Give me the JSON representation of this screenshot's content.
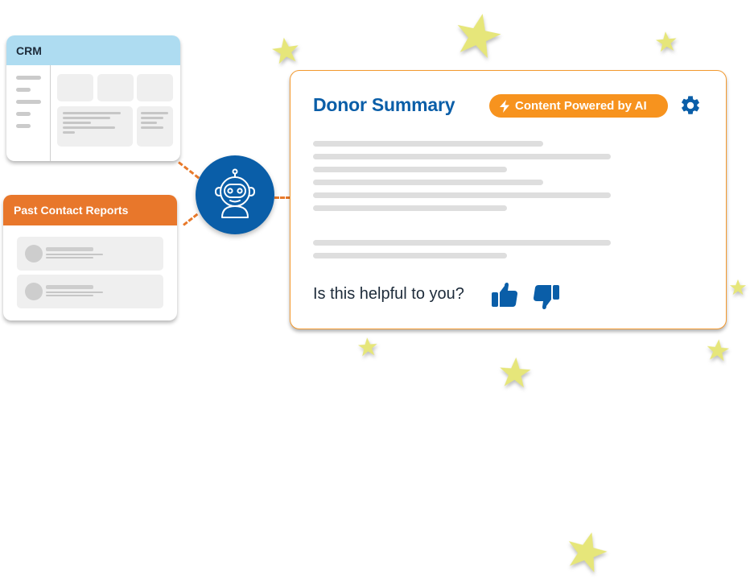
{
  "colors": {
    "crm_header": "#aedcf1",
    "reports_header": "#e8772b",
    "brand_blue": "#0a5ea8",
    "ai_orange": "#f7931e",
    "star_yellow": "#e6e67a",
    "connector": "#e8792a"
  },
  "crm": {
    "title": "CRM"
  },
  "reports": {
    "title": "Past Contact Reports"
  },
  "robot": {
    "icon": "robot-icon"
  },
  "donor_summary": {
    "title": "Donor Summary",
    "badge": {
      "icon": "lightning-icon",
      "label": "Content Powered by AI"
    },
    "settings_icon": "gear-icon",
    "feedback": {
      "question": "Is this helpful to you?",
      "like_icon": "thumbs-up-icon",
      "dislike_icon": "thumbs-down-icon"
    }
  }
}
